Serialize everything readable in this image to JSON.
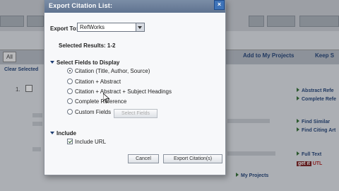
{
  "dialog": {
    "title": "Export Citation List:",
    "close_glyph": "×",
    "export_to_label": "Export To:",
    "export_to_value": "RefWorks",
    "selected_results": "Selected Results: 1-2",
    "fields_heading": "Select Fields to Display",
    "field_options": [
      {
        "label": "Citation (Title, Author, Source)",
        "checked": true
      },
      {
        "label": "Citation + Abstract",
        "checked": false
      },
      {
        "label": "Citation + Abstract + Subject Headings",
        "checked": false
      },
      {
        "label": "Complete Reference",
        "checked": false
      },
      {
        "label": "Custom Fields",
        "checked": false
      }
    ],
    "select_fields_button": "Select Fields",
    "include_heading": "Include",
    "include_url_label": "Include URL",
    "include_url_checked": true,
    "cancel_button": "Cancel",
    "export_button": "Export Citation(s)"
  },
  "background": {
    "all_label": "All",
    "toolbar_add": "Add to My Projects",
    "toolbar_keep": "Keep S",
    "clear_selected": "Clear Selected",
    "record_number": "1.",
    "right_links": [
      "Abstract Refe",
      "Complete Refe",
      "Find Similar",
      "Find Citing Art",
      "Full Text"
    ],
    "getit": "get it",
    "getit_suffix": "UTL",
    "my_projects": "My Projects"
  }
}
